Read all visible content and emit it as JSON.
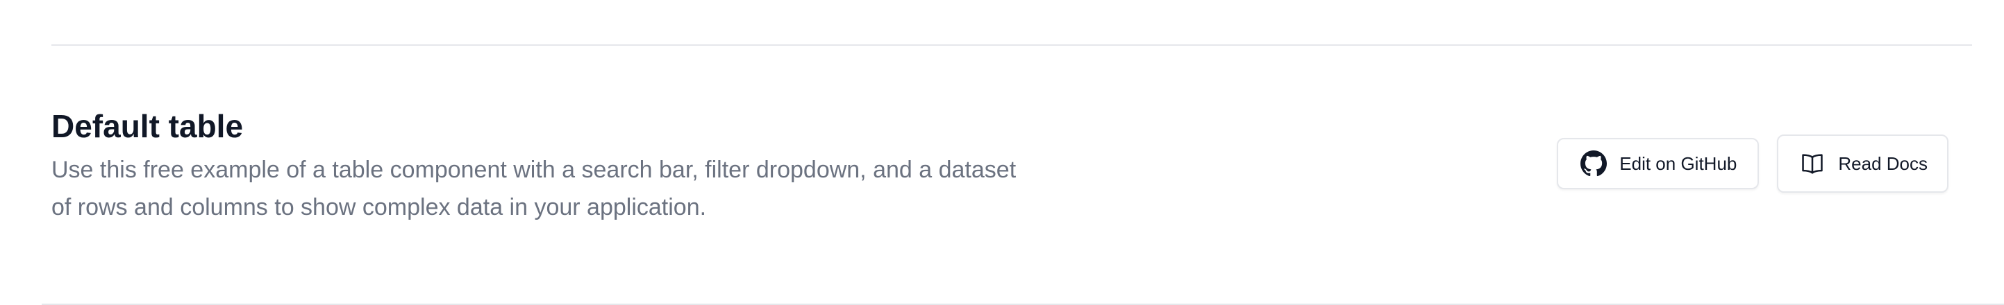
{
  "section": {
    "title": "Default table",
    "description": "Use this free example of a table component with a search bar, filter dropdown, and a dataset of rows and columns to show complex data in your application."
  },
  "actions": {
    "github": {
      "label": "Edit on GitHub",
      "icon": "github-icon"
    },
    "docs": {
      "label": "Read Docs",
      "icon": "book-open-icon"
    }
  },
  "colors": {
    "title": "#111827",
    "description": "#6b7280",
    "divider": "#e5e7eb",
    "button_border": "#e5e7eb",
    "background": "#ffffff"
  }
}
